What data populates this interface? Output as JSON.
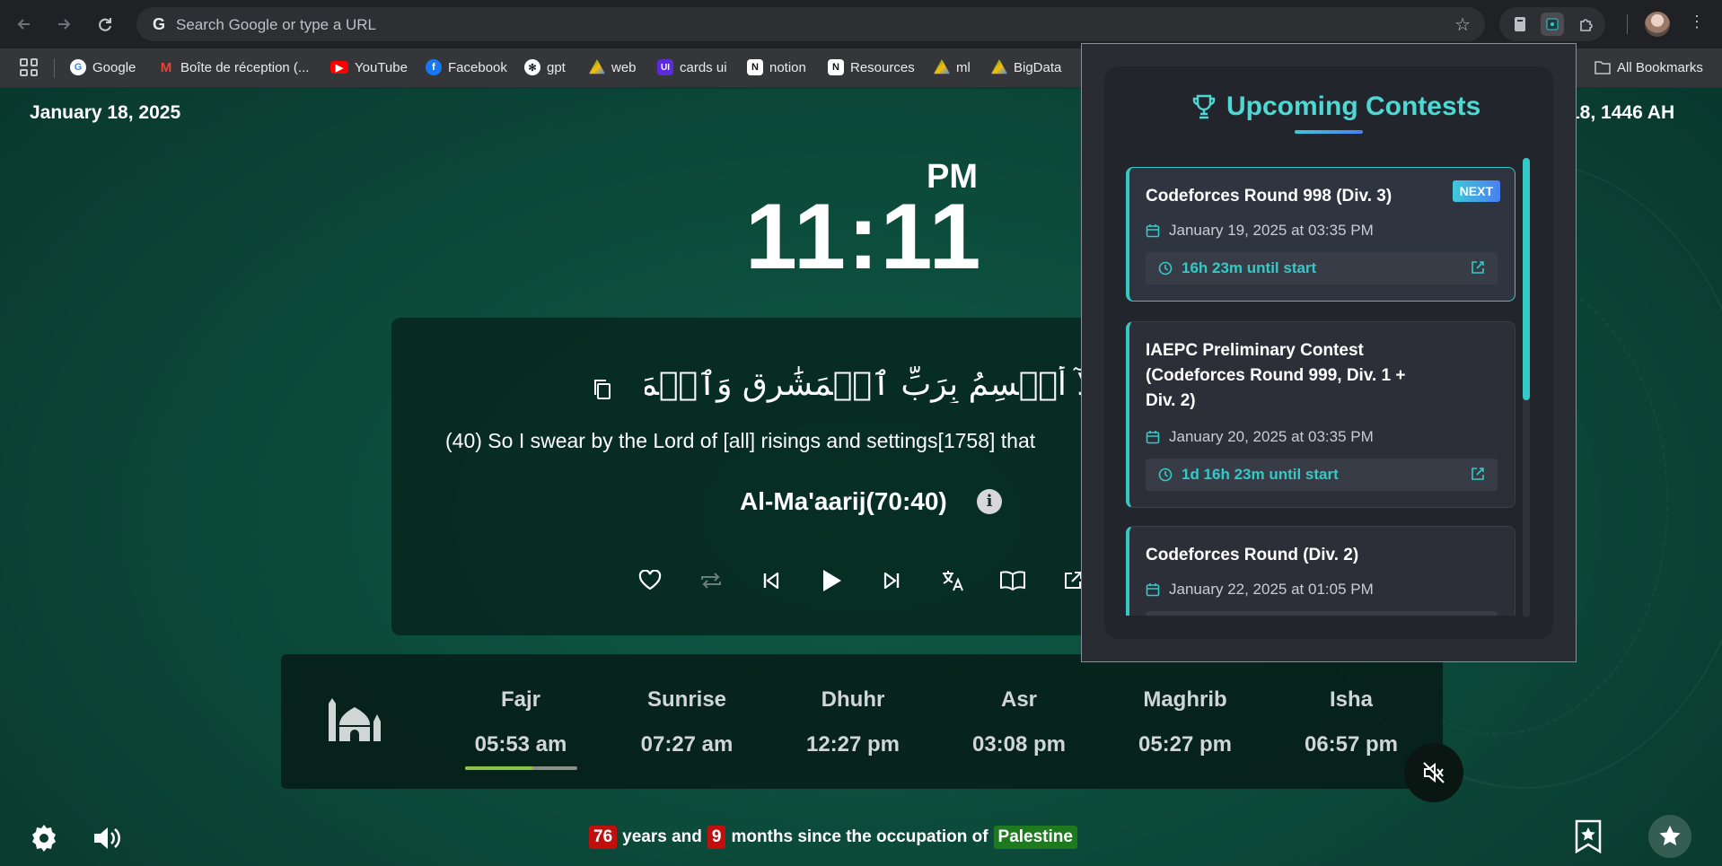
{
  "browser": {
    "omnibox_placeholder": "Search Google or type a URL",
    "bookmarks": [
      "Google",
      "Boîte de réception (...",
      "YouTube",
      "Facebook",
      "gpt",
      "web",
      "cards ui",
      "notion",
      "Resources",
      "ml",
      "BigData"
    ],
    "all_bookmarks": "All Bookmarks"
  },
  "page": {
    "gregorian_date": "January 18, 2025",
    "hijri_date": "18, 1446 AH",
    "clock": "11:11",
    "ampm": "PM",
    "verse_arabic": "فَلَآ أُقۡسِمُ بِرَبِّ ٱلۡمَشَٰرِقِ وَٱلۡمَغَٰرِبِ إِنَّا لَقَٰدِرُونَ",
    "verse_translation": "(40) So I swear by the Lord of [all] risings and settings[1758] that",
    "surah_ref": "Al-Ma'aarij(70:40)",
    "info": "i",
    "prayers": [
      {
        "name": "Fajr",
        "time": "05:53 am"
      },
      {
        "name": "Sunrise",
        "time": "07:27 am"
      },
      {
        "name": "Dhuhr",
        "time": "12:27 pm"
      },
      {
        "name": "Asr",
        "time": "03:08 pm"
      },
      {
        "name": "Maghrib",
        "time": "05:27 pm"
      },
      {
        "name": "Isha",
        "time": "06:57 pm"
      }
    ],
    "fajr_progress": 0.6,
    "footer": {
      "years": "76",
      "years_text": "years and",
      "months": "9",
      "months_text": "months since the occupation of",
      "place": "Palestine"
    }
  },
  "popup": {
    "title": "Upcoming Contests",
    "next_badge": "NEXT",
    "contests": [
      {
        "name": "Codeforces Round 998 (Div. 3)",
        "date": "January 19, 2025 at 03:35 PM",
        "until": "16h 23m until start"
      },
      {
        "name": "IAEPC Preliminary Contest (Codeforces Round 999, Div. 1 + Div. 2)",
        "date": "January 20, 2025 at 03:35 PM",
        "until": "1d 16h 23m until start"
      },
      {
        "name": "Codeforces Round (Div. 2)",
        "date": "January 22, 2025 at 01:05 PM",
        "until": ""
      }
    ]
  },
  "colors": {
    "accent": "#35c9c6",
    "red": "#c0100e",
    "green": "#1e7a1e"
  }
}
